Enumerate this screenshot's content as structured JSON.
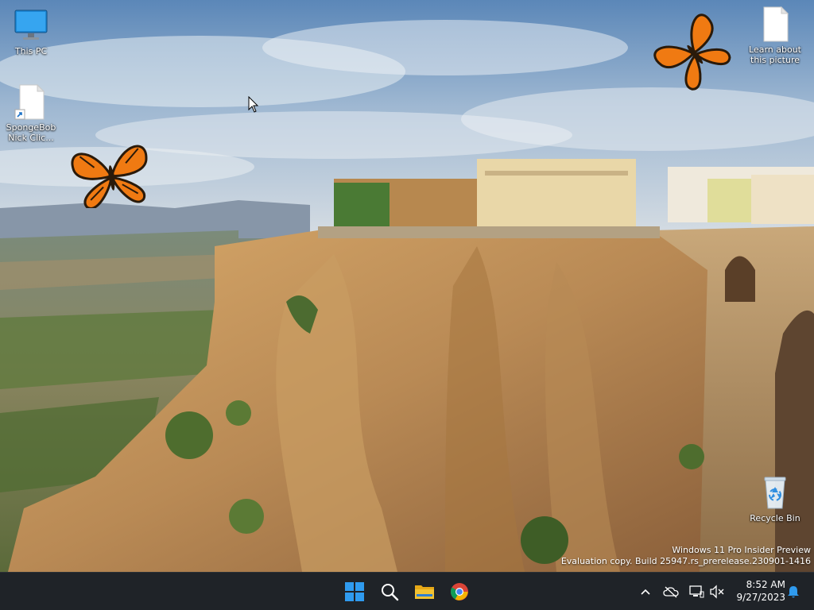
{
  "desktop_icons": [
    {
      "label": "This PC",
      "icon": "monitor-icon"
    },
    {
      "label": "SpongeBob Nick Clic...",
      "icon": "shortcut-file-icon"
    },
    {
      "label": "Learn about this picture",
      "icon": "file-icon"
    },
    {
      "label": "Recycle Bin",
      "icon": "recycle-bin-icon"
    }
  ],
  "watermark": {
    "line1": "Windows 11 Pro Insider Preview",
    "line2": "Evaluation copy. Build 25947.rs_prerelease.230901-1416"
  },
  "taskbar": {
    "apps": [
      {
        "name": "Start",
        "icon": "windows-logo-icon"
      },
      {
        "name": "Search",
        "icon": "search-icon"
      },
      {
        "name": "File Explorer",
        "icon": "folder-icon"
      },
      {
        "name": "Google Chrome",
        "icon": "chrome-icon"
      }
    ],
    "tray": {
      "time": "8:52 AM",
      "date": "9/27/2023"
    }
  },
  "colors": {
    "taskbar_bg": "#1f2328",
    "start_blue": "#2f9bef",
    "folder_yellow": "#f2c231",
    "butterfly_orange": "#f07a12"
  }
}
